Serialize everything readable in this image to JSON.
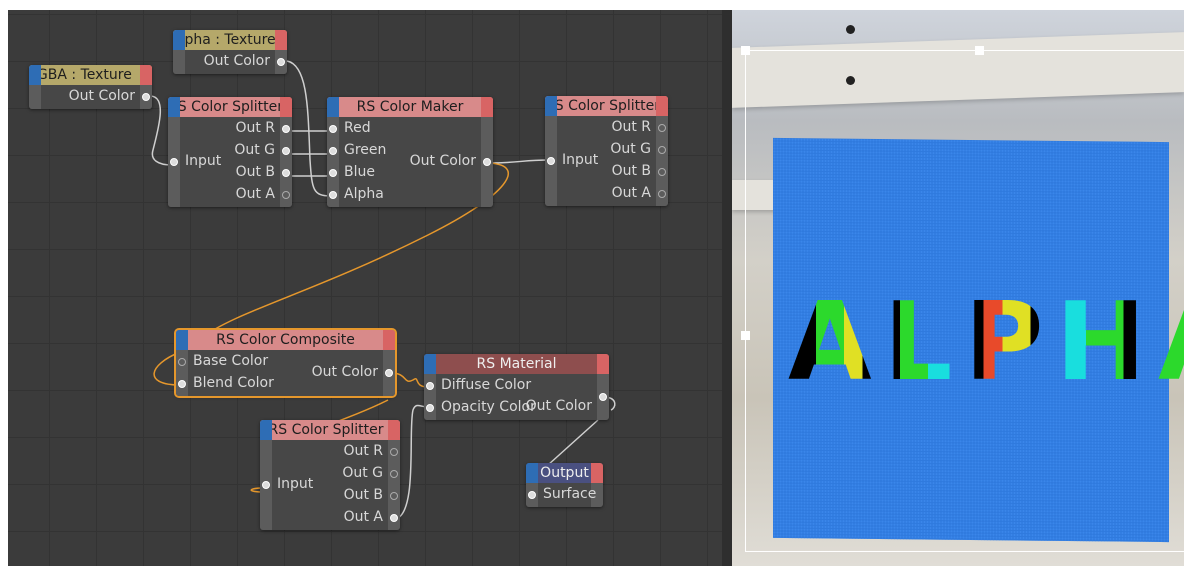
{
  "nodes": [
    {
      "id": "rgba-texture",
      "title": "RGBA : Texture",
      "header_color": "#b5a86a",
      "inputs": [],
      "outputs": [
        {
          "label": "Out Color",
          "on": true
        }
      ]
    },
    {
      "id": "alpha-texture",
      "title": "Alpha : Texture",
      "header_color": "#b5a86a",
      "inputs": [],
      "outputs": [
        {
          "label": "Out Color",
          "on": true
        }
      ]
    },
    {
      "id": "color-splitter-1",
      "title": "RS Color Splitter",
      "header_color": "#d88a8a",
      "inputs": [
        {
          "label": "Input",
          "on": true
        }
      ],
      "outputs": [
        {
          "label": "Out R",
          "on": true
        },
        {
          "label": "Out G",
          "on": true
        },
        {
          "label": "Out B",
          "on": true
        },
        {
          "label": "Out A",
          "on": false
        }
      ]
    },
    {
      "id": "color-maker",
      "title": "RS Color Maker",
      "header_color": "#d88a8a",
      "inputs": [
        {
          "label": "Red",
          "on": true
        },
        {
          "label": "Green",
          "on": true
        },
        {
          "label": "Blue",
          "on": true
        },
        {
          "label": "Alpha",
          "on": true
        }
      ],
      "outputs": [
        {
          "label": "Out Color",
          "on": true
        }
      ]
    },
    {
      "id": "color-splitter-2",
      "title": "RS Color Splitter",
      "header_color": "#d88a8a",
      "inputs": [
        {
          "label": "Input",
          "on": true
        }
      ],
      "outputs": [
        {
          "label": "Out R",
          "on": false
        },
        {
          "label": "Out G",
          "on": false
        },
        {
          "label": "Out B",
          "on": false
        },
        {
          "label": "Out A",
          "on": false
        }
      ]
    },
    {
      "id": "color-composite",
      "title": "RS Color Composite",
      "header_color": "#d88a8a",
      "inputs": [
        {
          "label": "Base Color",
          "on": false
        },
        {
          "label": "Blend Color",
          "on": true
        }
      ],
      "outputs": [
        {
          "label": "Out Color",
          "on": true
        }
      ]
    },
    {
      "id": "rs-material",
      "title": "RS Material",
      "header_color": "#8e4e4e",
      "inputs": [
        {
          "label": "Diffuse Color",
          "on": true
        },
        {
          "label": "Opacity Color",
          "on": true
        }
      ],
      "outputs": [
        {
          "label": "Out Color",
          "on": true
        }
      ]
    },
    {
      "id": "color-splitter-3",
      "title": "RS Color Splitter",
      "header_color": "#d88a8a",
      "inputs": [
        {
          "label": "Input",
          "on": true
        }
      ],
      "outputs": [
        {
          "label": "Out R",
          "on": false
        },
        {
          "label": "Out G",
          "on": false
        },
        {
          "label": "Out B",
          "on": false
        },
        {
          "label": "Out A",
          "on": true
        }
      ]
    },
    {
      "id": "output",
      "title": "Output",
      "header_color": "#4a5080",
      "inputs": [
        {
          "label": "Surface",
          "on": true
        }
      ],
      "outputs": []
    }
  ],
  "viewport": {
    "render_text": "ALPHA",
    "plane_color": "#2f7ade"
  },
  "colors": {
    "selected_wire": "#e5972c",
    "wire": "#cfcfcf"
  }
}
